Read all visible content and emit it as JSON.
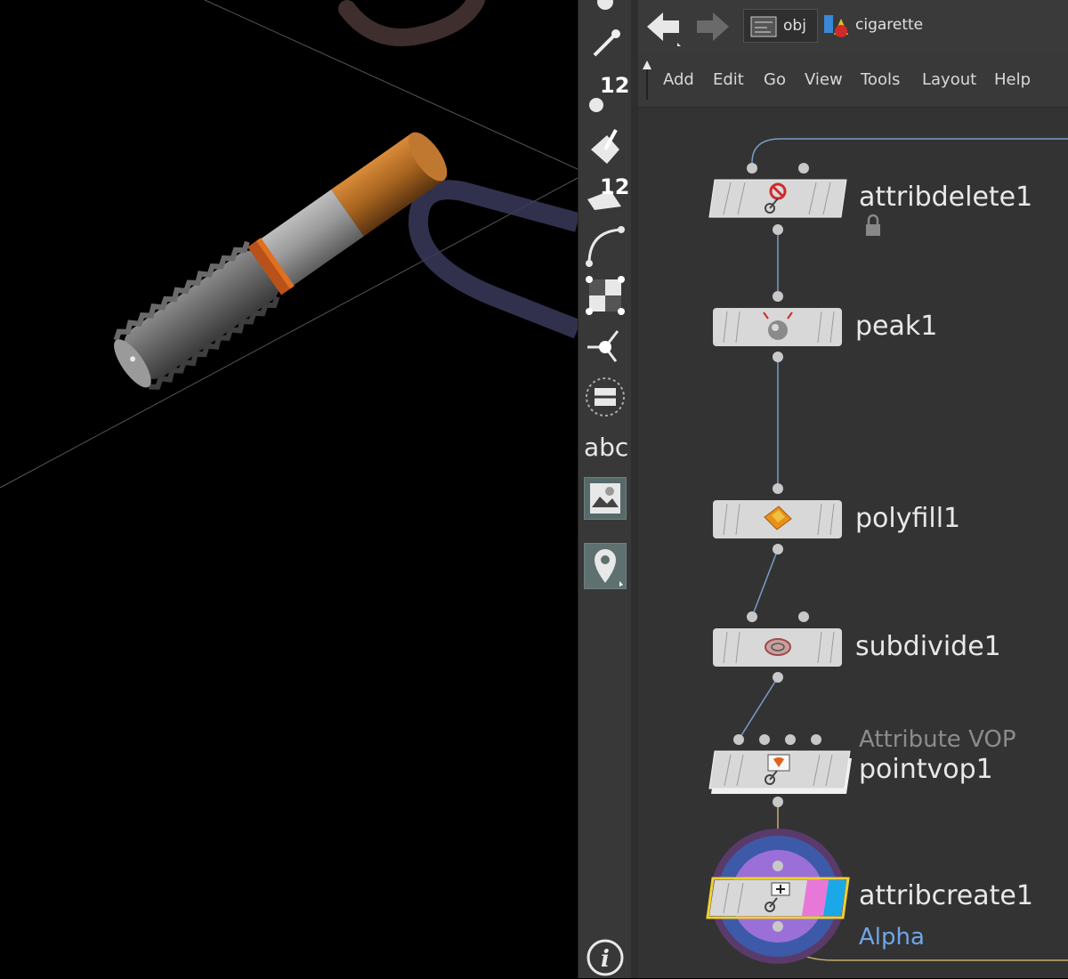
{
  "path": {
    "items": [
      {
        "label": "obj",
        "icon": "object-network-icon"
      },
      {
        "label": "cigarette",
        "icon": "geometry-object-icon"
      }
    ]
  },
  "menu": [
    "Add",
    "Edit",
    "Go",
    "View",
    "Tools",
    "Layout",
    "Help"
  ],
  "toolbar": {
    "point_size_label": "12",
    "text_size_label": "12",
    "text_tool_label": "abc"
  },
  "nodes": [
    {
      "name": "attribdelete1",
      "type": "",
      "comment": "",
      "icon": "attribdelete-icon",
      "locked": true,
      "selected": false
    },
    {
      "name": "peak1",
      "type": "",
      "comment": "",
      "icon": "peak-icon",
      "locked": false,
      "selected": false
    },
    {
      "name": "polyfill1",
      "type": "",
      "comment": "",
      "icon": "polyfill-icon",
      "locked": false,
      "selected": false
    },
    {
      "name": "subdivide1",
      "type": "",
      "comment": "",
      "icon": "subdivide-icon",
      "locked": false,
      "selected": false
    },
    {
      "name": "pointvop1",
      "type": "Attribute VOP",
      "comment": "",
      "icon": "attribute-vop-icon",
      "locked": false,
      "selected": false
    },
    {
      "name": "attribcreate1",
      "type": "",
      "comment": "Alpha",
      "icon": "attribcreate-icon",
      "locked": false,
      "selected": true
    }
  ],
  "colors": {
    "display_flag": "#e878d8",
    "render_flag": "#1aa8e8",
    "selected_outline": "#f0d030",
    "wire": "#7a9cc6",
    "comment": "#6fa6e6"
  }
}
